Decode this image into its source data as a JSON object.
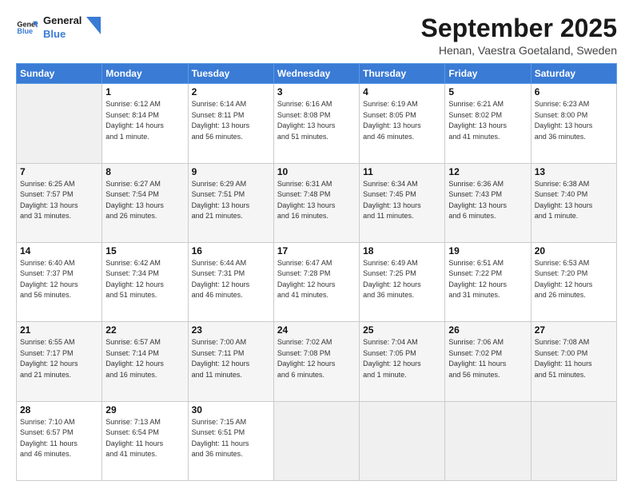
{
  "header": {
    "logo_line1": "General",
    "logo_line2": "Blue",
    "month": "September 2025",
    "location": "Henan, Vaestra Goetaland, Sweden"
  },
  "weekdays": [
    "Sunday",
    "Monday",
    "Tuesday",
    "Wednesday",
    "Thursday",
    "Friday",
    "Saturday"
  ],
  "weeks": [
    [
      {
        "day": "",
        "info": ""
      },
      {
        "day": "1",
        "info": "Sunrise: 6:12 AM\nSunset: 8:14 PM\nDaylight: 14 hours\nand 1 minute."
      },
      {
        "day": "2",
        "info": "Sunrise: 6:14 AM\nSunset: 8:11 PM\nDaylight: 13 hours\nand 56 minutes."
      },
      {
        "day": "3",
        "info": "Sunrise: 6:16 AM\nSunset: 8:08 PM\nDaylight: 13 hours\nand 51 minutes."
      },
      {
        "day": "4",
        "info": "Sunrise: 6:19 AM\nSunset: 8:05 PM\nDaylight: 13 hours\nand 46 minutes."
      },
      {
        "day": "5",
        "info": "Sunrise: 6:21 AM\nSunset: 8:02 PM\nDaylight: 13 hours\nand 41 minutes."
      },
      {
        "day": "6",
        "info": "Sunrise: 6:23 AM\nSunset: 8:00 PM\nDaylight: 13 hours\nand 36 minutes."
      }
    ],
    [
      {
        "day": "7",
        "info": "Sunrise: 6:25 AM\nSunset: 7:57 PM\nDaylight: 13 hours\nand 31 minutes."
      },
      {
        "day": "8",
        "info": "Sunrise: 6:27 AM\nSunset: 7:54 PM\nDaylight: 13 hours\nand 26 minutes."
      },
      {
        "day": "9",
        "info": "Sunrise: 6:29 AM\nSunset: 7:51 PM\nDaylight: 13 hours\nand 21 minutes."
      },
      {
        "day": "10",
        "info": "Sunrise: 6:31 AM\nSunset: 7:48 PM\nDaylight: 13 hours\nand 16 minutes."
      },
      {
        "day": "11",
        "info": "Sunrise: 6:34 AM\nSunset: 7:45 PM\nDaylight: 13 hours\nand 11 minutes."
      },
      {
        "day": "12",
        "info": "Sunrise: 6:36 AM\nSunset: 7:43 PM\nDaylight: 13 hours\nand 6 minutes."
      },
      {
        "day": "13",
        "info": "Sunrise: 6:38 AM\nSunset: 7:40 PM\nDaylight: 13 hours\nand 1 minute."
      }
    ],
    [
      {
        "day": "14",
        "info": "Sunrise: 6:40 AM\nSunset: 7:37 PM\nDaylight: 12 hours\nand 56 minutes."
      },
      {
        "day": "15",
        "info": "Sunrise: 6:42 AM\nSunset: 7:34 PM\nDaylight: 12 hours\nand 51 minutes."
      },
      {
        "day": "16",
        "info": "Sunrise: 6:44 AM\nSunset: 7:31 PM\nDaylight: 12 hours\nand 46 minutes."
      },
      {
        "day": "17",
        "info": "Sunrise: 6:47 AM\nSunset: 7:28 PM\nDaylight: 12 hours\nand 41 minutes."
      },
      {
        "day": "18",
        "info": "Sunrise: 6:49 AM\nSunset: 7:25 PM\nDaylight: 12 hours\nand 36 minutes."
      },
      {
        "day": "19",
        "info": "Sunrise: 6:51 AM\nSunset: 7:22 PM\nDaylight: 12 hours\nand 31 minutes."
      },
      {
        "day": "20",
        "info": "Sunrise: 6:53 AM\nSunset: 7:20 PM\nDaylight: 12 hours\nand 26 minutes."
      }
    ],
    [
      {
        "day": "21",
        "info": "Sunrise: 6:55 AM\nSunset: 7:17 PM\nDaylight: 12 hours\nand 21 minutes."
      },
      {
        "day": "22",
        "info": "Sunrise: 6:57 AM\nSunset: 7:14 PM\nDaylight: 12 hours\nand 16 minutes."
      },
      {
        "day": "23",
        "info": "Sunrise: 7:00 AM\nSunset: 7:11 PM\nDaylight: 12 hours\nand 11 minutes."
      },
      {
        "day": "24",
        "info": "Sunrise: 7:02 AM\nSunset: 7:08 PM\nDaylight: 12 hours\nand 6 minutes."
      },
      {
        "day": "25",
        "info": "Sunrise: 7:04 AM\nSunset: 7:05 PM\nDaylight: 12 hours\nand 1 minute."
      },
      {
        "day": "26",
        "info": "Sunrise: 7:06 AM\nSunset: 7:02 PM\nDaylight: 11 hours\nand 56 minutes."
      },
      {
        "day": "27",
        "info": "Sunrise: 7:08 AM\nSunset: 7:00 PM\nDaylight: 11 hours\nand 51 minutes."
      }
    ],
    [
      {
        "day": "28",
        "info": "Sunrise: 7:10 AM\nSunset: 6:57 PM\nDaylight: 11 hours\nand 46 minutes."
      },
      {
        "day": "29",
        "info": "Sunrise: 7:13 AM\nSunset: 6:54 PM\nDaylight: 11 hours\nand 41 minutes."
      },
      {
        "day": "30",
        "info": "Sunrise: 7:15 AM\nSunset: 6:51 PM\nDaylight: 11 hours\nand 36 minutes."
      },
      {
        "day": "",
        "info": ""
      },
      {
        "day": "",
        "info": ""
      },
      {
        "day": "",
        "info": ""
      },
      {
        "day": "",
        "info": ""
      }
    ]
  ]
}
